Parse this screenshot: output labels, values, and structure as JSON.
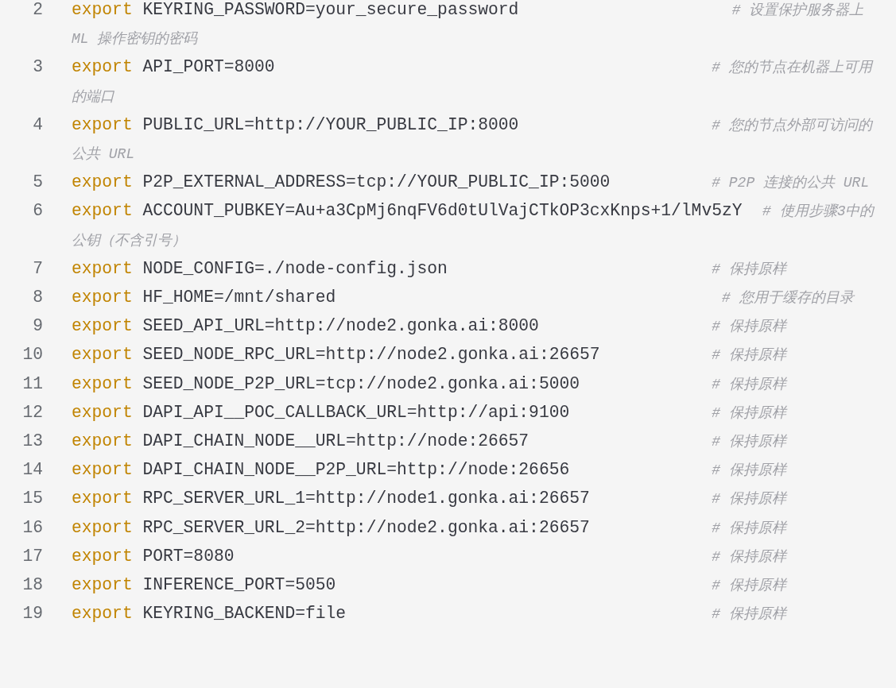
{
  "code_lines": [
    {
      "number": "2",
      "keyword": "export",
      "code": "KEYRING_PASSWORD=your_secure_password                     ",
      "comment": "# 设置保护服务器上 ML 操作密钥的密码"
    },
    {
      "number": "3",
      "keyword": "export",
      "code": "API_PORT=8000                                           ",
      "comment": "# 您的节点在机器上可用的端口"
    },
    {
      "number": "4",
      "keyword": "export",
      "code": "PUBLIC_URL=http://YOUR_PUBLIC_IP:8000                   ",
      "comment": "# 您的节点外部可访问的公共 URL"
    },
    {
      "number": "5",
      "keyword": "export",
      "code": "P2P_EXTERNAL_ADDRESS=tcp://YOUR_PUBLIC_IP:5000          ",
      "comment": "# P2P 连接的公共 URL"
    },
    {
      "number": "6",
      "keyword": "export",
      "code": "ACCOUNT_PUBKEY=Au+a3CpMj6nqFV6d0tUlVajCTkOP3cxKnps+1/lMv5zY  ",
      "comment": "# 使用步骤3中的公钥（不含引号）"
    },
    {
      "number": "7",
      "keyword": "export",
      "code": "NODE_CONFIG=./node-config.json                          ",
      "comment": "# 保持原样"
    },
    {
      "number": "8",
      "keyword": "export",
      "code": "HF_HOME=/mnt/shared                                      ",
      "comment": "# 您用于缓存的目录"
    },
    {
      "number": "9",
      "keyword": "export",
      "code": "SEED_API_URL=http://node2.gonka.ai:8000                 ",
      "comment": "# 保持原样"
    },
    {
      "number": "10",
      "keyword": "export",
      "code": "SEED_NODE_RPC_URL=http://node2.gonka.ai:26657           ",
      "comment": "# 保持原样"
    },
    {
      "number": "11",
      "keyword": "export",
      "code": "SEED_NODE_P2P_URL=tcp://node2.gonka.ai:5000             ",
      "comment": "# 保持原样"
    },
    {
      "number": "12",
      "keyword": "export",
      "code": "DAPI_API__POC_CALLBACK_URL=http://api:9100              ",
      "comment": "# 保持原样"
    },
    {
      "number": "13",
      "keyword": "export",
      "code": "DAPI_CHAIN_NODE__URL=http://node:26657                  ",
      "comment": "# 保持原样"
    },
    {
      "number": "14",
      "keyword": "export",
      "code": "DAPI_CHAIN_NODE__P2P_URL=http://node:26656              ",
      "comment": "# 保持原样"
    },
    {
      "number": "15",
      "keyword": "export",
      "code": "RPC_SERVER_URL_1=http://node1.gonka.ai:26657            ",
      "comment": "# 保持原样"
    },
    {
      "number": "16",
      "keyword": "export",
      "code": "RPC_SERVER_URL_2=http://node2.gonka.ai:26657            ",
      "comment": "# 保持原样"
    },
    {
      "number": "17",
      "keyword": "export",
      "code": "PORT=8080                                               ",
      "comment": "# 保持原样"
    },
    {
      "number": "18",
      "keyword": "export",
      "code": "INFERENCE_PORT=5050                                     ",
      "comment": "# 保持原样"
    },
    {
      "number": "19",
      "keyword": "export",
      "code": "KEYRING_BACKEND=file                                    ",
      "comment": "# 保持原样"
    }
  ]
}
